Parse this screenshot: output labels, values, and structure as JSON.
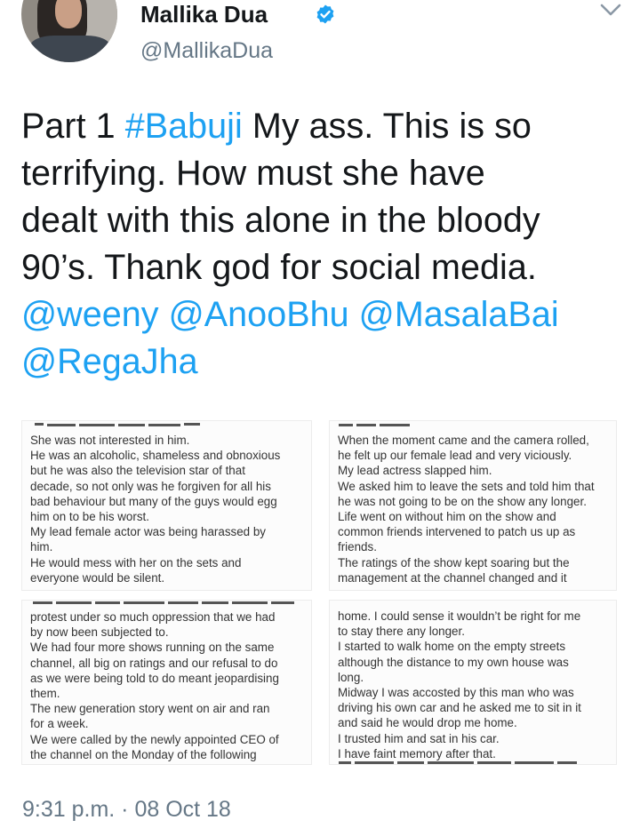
{
  "user": {
    "name": "Mallika Dua",
    "handle": "@MallikaDua"
  },
  "icons": {
    "verified": "verified-badge-icon",
    "menu": "chevron-down-icon",
    "brand_color": "#1da1f2",
    "muted_color": "#657786"
  },
  "tweet": {
    "line1_a": "Part 1 ",
    "line1_hashtag": "#Babuji",
    "line1_b": " My ass. This is so",
    "line2": "terrifying. How must she have",
    "line3": "dealt with this alone in the bloody",
    "line4": "90’s. Thank god for social media.",
    "line5_mention1": "@weeny",
    "line5_mention2": "@AnooBhu",
    "line5_mention3": "@MasalaBai",
    "line6_mention4": "@RegaJha"
  },
  "screenshots": [
    {
      "lines": [
        "She was not interested in him.",
        "He was an alcoholic, shameless and obnoxious",
        "but he was also the television star of that",
        "decade, so not only was he forgiven for all his",
        "bad behaviour but many of the guys would egg",
        "him on to be his worst.",
        "My lead female actor was being harassed by",
        "him.",
        "He would mess with her on the sets and",
        "everyone would be silent."
      ]
    },
    {
      "lines": [
        "When the moment came and the camera rolled,",
        "he felt up our female lead and very viciously.",
        "My lead actress slapped him.",
        "We asked him to leave the sets and told him that",
        "he was not going to be on the show any longer.",
        "Life went on without him on the show and",
        "common friends intervened to patch us up as",
        "friends.",
        "The ratings of the show kept soaring but the",
        "management at the channel changed and it"
      ]
    },
    {
      "lines": [
        "protest under so much oppression that we had",
        "by now been subjected to.",
        "We had four more shows running on the same",
        "channel, all big on ratings and our refusal to do",
        "as we were being told to do meant jeopardising",
        "them.",
        "The new generation story went on air and ran",
        "for a week.",
        "We were called by the newly appointed CEO of",
        "the channel on the Monday of the following"
      ]
    },
    {
      "lines": [
        "home. I could sense it wouldn’t be right for me",
        "to stay there any longer.",
        "I started to walk home on the empty streets",
        "although the distance to my own house was",
        "long.",
        "Midway I was accosted by this man who was",
        "driving his own car and he asked me to sit in it",
        "and said he would drop me home.",
        "I trusted him and sat in his car.",
        "I have faint memory after that."
      ]
    }
  ],
  "timestamp": "9:31 p.m. · 08 Oct 18"
}
